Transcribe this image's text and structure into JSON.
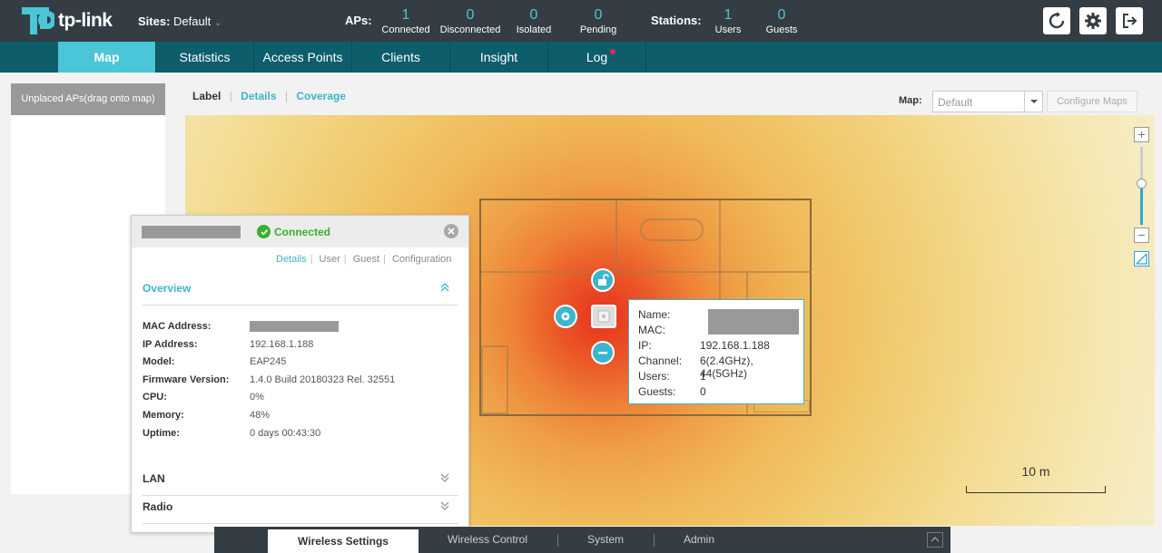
{
  "header": {
    "logo_text": "tp-link",
    "sites_label": "Sites:",
    "sites_value": "Default",
    "aps_label": "APs:",
    "aps": [
      {
        "num": "1",
        "label": "Connected"
      },
      {
        "num": "0",
        "label": "Disconnected"
      },
      {
        "num": "0",
        "label": "Isolated"
      },
      {
        "num": "0",
        "label": "Pending"
      }
    ],
    "stations_label": "Stations:",
    "stations": [
      {
        "num": "1",
        "label": "Users"
      },
      {
        "num": "0",
        "label": "Guests"
      }
    ]
  },
  "nav": {
    "items": [
      "Map",
      "Statistics",
      "Access Points",
      "Clients",
      "Insight",
      "Log"
    ],
    "active": "Map"
  },
  "left_panel": {
    "unplaced_label": "Unplaced APs(drag onto map)"
  },
  "map_toolbar": {
    "view_tabs": [
      "Label",
      "Details",
      "Coverage"
    ],
    "map_label": "Map:",
    "map_value": "Default",
    "configure_label": "Configure Maps"
  },
  "map": {
    "scale_label": "10 m"
  },
  "tooltip": {
    "rows": [
      {
        "key": "Name:",
        "value": ""
      },
      {
        "key": "MAC:",
        "value": ""
      },
      {
        "key": "IP:",
        "value": "192.168.1.188"
      },
      {
        "key": "Channel:",
        "value": "6(2.4GHz), 44(5GHz)"
      },
      {
        "key": "Users:",
        "value": "1"
      },
      {
        "key": "Guests:",
        "value": "0"
      }
    ]
  },
  "popup": {
    "status": "Connected",
    "tabs": [
      "Details",
      "User",
      "Guest",
      "Configuration"
    ],
    "overview_title": "Overview",
    "overview": [
      {
        "key": "MAC Address:",
        "value": ""
      },
      {
        "key": "IP Address:",
        "value": "192.168.1.188"
      },
      {
        "key": "Model:",
        "value": "EAP245"
      },
      {
        "key": "Firmware Version:",
        "value": "1.4.0 Build 20180323 Rel. 32551"
      },
      {
        "key": "CPU:",
        "value": "0%"
      },
      {
        "key": "Memory:",
        "value": "48%"
      },
      {
        "key": "Uptime:",
        "value": "0 days 00:43:30"
      }
    ],
    "lan_title": "LAN",
    "radio_title": "Radio"
  },
  "bottom_bar": {
    "items": [
      "Wireless Settings",
      "Wireless Control",
      "System",
      "Admin"
    ]
  },
  "colors": {
    "header_bg": "#343d43",
    "nav_bg": "#0d5d6b",
    "accent": "#4ac6d7",
    "connected_green": "#35b12c"
  }
}
